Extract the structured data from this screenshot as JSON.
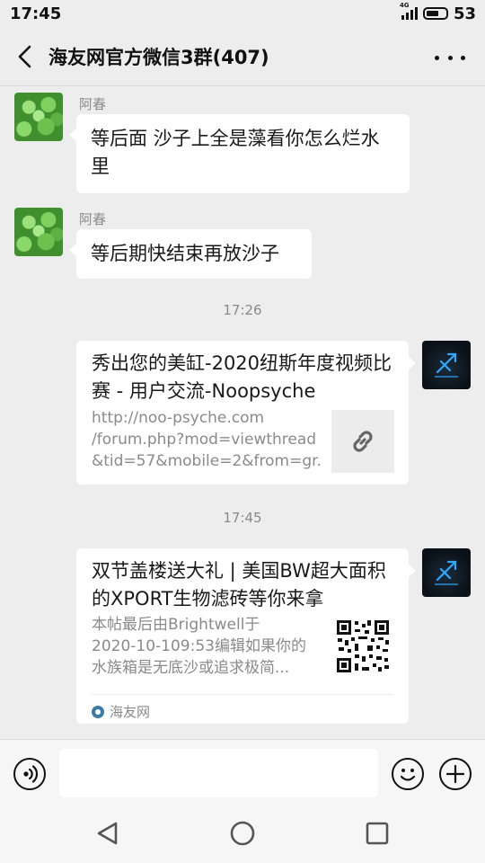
{
  "status_bar": {
    "time": "17:45",
    "network": "4G",
    "battery": "53"
  },
  "header": {
    "title": "海友网官方微信3群(407)"
  },
  "messages": [
    {
      "sender": "阿春",
      "text": "等后面 沙子上全是藻看你怎么烂水里"
    },
    {
      "sender": "阿春",
      "text": "等后期快结束再放沙子"
    }
  ],
  "timestamps": [
    "17:26",
    "17:45"
  ],
  "link_cards": [
    {
      "title": "秀出您的美缸-2020纽斯年度视频比赛 - 用户交流-Noopsyche",
      "desc_lines": [
        "http://noo-psyche.com",
        "/forum.php?mod=viewthread",
        "&tid=57&mobile=2&from=gr..."
      ],
      "thumb_icon": "link-icon"
    },
    {
      "title": "双节盖楼送大礼 | 美国BW超大面积的XPORT生物滤砖等你来拿",
      "desc_lines": [
        "本帖最后由Brightwell于",
        "2020-10-109:53编辑如果你的",
        "水族箱是无底沙或追求极简..."
      ],
      "thumb_icon": "qr-code-icon",
      "source": "海友网"
    }
  ],
  "input": {
    "placeholder": ""
  },
  "colors": {
    "background": "#ededed",
    "bubble": "#ffffff",
    "meta_text": "#8a8a8a"
  }
}
